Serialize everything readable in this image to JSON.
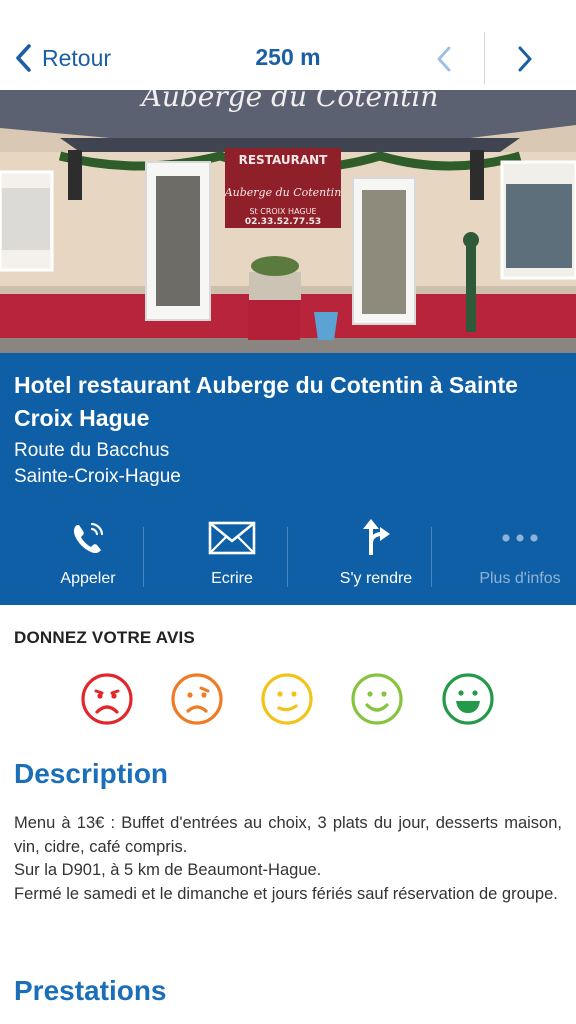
{
  "header": {
    "back_label": "Retour",
    "distance": "250 m"
  },
  "photo": {
    "sign_restaurant": "RESTAURANT",
    "sign_name": "Auberge du Cotentin",
    "sign_place": "St CROIX HAGUE",
    "sign_phone": "02.33.52.77.53",
    "roof_sign": "Auberge du Cotentin"
  },
  "place": {
    "title": "Hotel restaurant Auberge du Cotentin à Sainte Croix Hague",
    "address_line1": "Route du Bacchus",
    "address_line2": "Sainte-Croix-Hague"
  },
  "actions": [
    {
      "label": "Appeler",
      "icon": "phone-icon"
    },
    {
      "label": "Ecrire",
      "icon": "envelope-icon"
    },
    {
      "label": "S'y rendre",
      "icon": "directions-icon"
    },
    {
      "label": "Plus d'infos",
      "icon": "more-icon"
    }
  ],
  "rating": {
    "title": "DONNEZ VOTRE AVIS",
    "options": [
      {
        "icon": "very-sad-icon",
        "color": "#e2262c"
      },
      {
        "icon": "sad-icon",
        "color": "#f07b23"
      },
      {
        "icon": "neutral-icon",
        "color": "#f2c31a"
      },
      {
        "icon": "smile-icon",
        "color": "#86c440"
      },
      {
        "icon": "happy-icon",
        "color": "#23994a"
      }
    ]
  },
  "description": {
    "heading": "Description",
    "lines": [
      "Menu à 13€ : Buffet d'entrées au choix, 3 plats du jour, desserts maison, vin, cidre, café compris.",
      "Sur la D901, à 5 km de Beaumont-Hague.",
      "Fermé le samedi et le dimanche et jours fériés sauf réservation de groupe."
    ]
  },
  "prestations": {
    "heading": "Prestations"
  },
  "colors": {
    "accent": "#1a5fa3",
    "panel": "#0f5fa6",
    "heading": "#1a6fb8"
  }
}
